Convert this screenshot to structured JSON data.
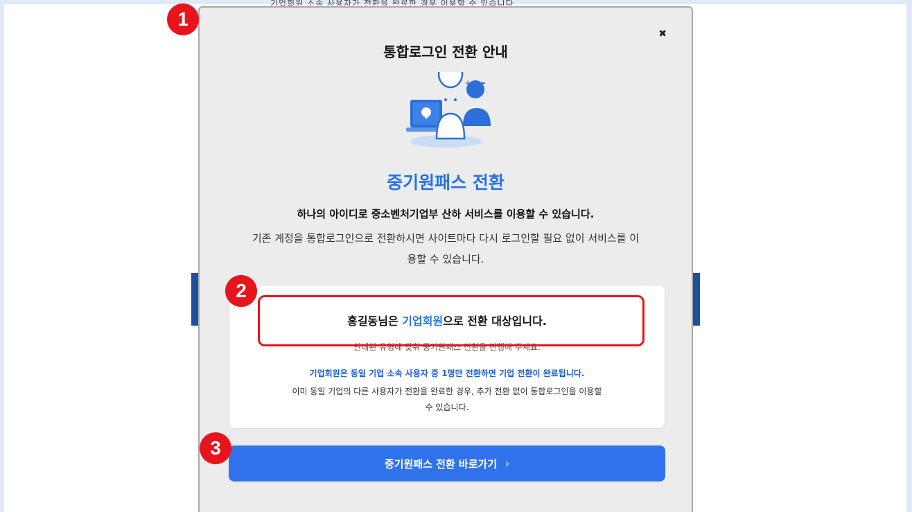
{
  "background": {
    "top_text": "기업회원 소속 사용자가 전환을 완료한 경우 이용할 수 있습니다"
  },
  "modal": {
    "close_icon": "close-icon",
    "title": "통합로그인 전환 안내",
    "pass_title": "중기원패스 전환",
    "intro_bold": "하나의 아이디로 중소벤처기업부 산하 서비스를 이용할 수 있습니다.",
    "intro_text": "기존 계정을 통합로그인으로 전환하시면 사이트마다 다시 로그인할 필요 없이 서비스를 이용할 수 있습니다."
  },
  "info_box": {
    "target_name": "홍길동님은 ",
    "target_type": "기업회원",
    "target_suffix": "으로 전환 대상입니다.",
    "target_sub": "안내된 유형에 맞춰 중기원패스 전환을 진행해 주세요.",
    "corp_note": "기업회원은 동일 기업 소속 사용자 중 1명만 전환하면 기업 전환이 완료됩니다.",
    "corp_desc": "이미 동일 기업의 다른 사용자가 전환을 완료한 경우, 추가 전환 없이 통합로그인을 이용할 수 있습니다."
  },
  "button": {
    "label": "중기원패스 전환 바로가기",
    "chevron": "›"
  },
  "markers": [
    "1",
    "2",
    "3"
  ],
  "colors": {
    "accent": "#2472e8",
    "button": "#2f72ec",
    "marker": "#e8141c"
  }
}
